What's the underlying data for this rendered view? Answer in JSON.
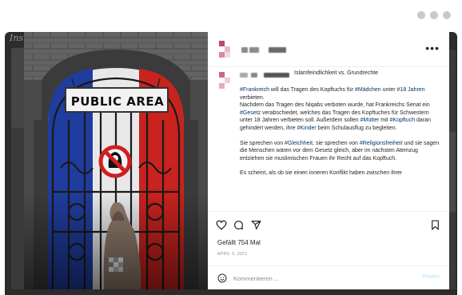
{
  "backdrop": {
    "logo_fragment": "Ins"
  },
  "photo": {
    "sign_text": "PUBLIC AREA",
    "colors": {
      "blue": "#1f3d9e",
      "white": "#e8e8ea",
      "red": "#c8231e",
      "stone": "#6b6b6b"
    }
  },
  "post": {
    "caption_title": "Islamfeindlichkeit vs. Grundrechte",
    "paragraph1": {
      "t1": "#Frankreich",
      "t2": " will das Tragen des Kopftuchs für ",
      "t3": "#Mädchen",
      "t4": " unter ",
      "t5": "#18 Jahren",
      "t6": " verbieten.",
      "t7": "Nachdem das Tragen des Niqabs verboten wurde, hat Frankreichs Senat ein ",
      "t8": "#Gesetz",
      "t9": " verabschiedet, welches das Tragen des Kopftuches für Schwestern unter 18 Jahren verbieten soll. Außerdem sollen ",
      "t10": "#Mütter",
      "t11": " mit ",
      "t12": "#Kopftuch",
      "t13": " daran gehindert werden, ihre ",
      "t14": "#Kinder",
      "t15": " beim Schulausflug zu begleiten."
    },
    "paragraph2": {
      "t1": "Sie sprechen von ",
      "t2": "#Gleichheit",
      "t3": ", sie sprechen von ",
      "t4": "#Religionsfreiheit",
      "t5": " und sie sagen die Menschen wären vor dem Gesetz gleich, aber im nächsten Atemzug entziehen sie muslimischen Frauen ihr Recht auf das Kopftuch."
    },
    "paragraph3": "Es scheint, als ob sie einen inneren Konflikt haben zwischen ihrer",
    "likes": "Gefällt 754 Mal",
    "date": "APRIL 3, 2021"
  },
  "comment": {
    "placeholder": "Kommentieren ...",
    "post_label": "Posten"
  }
}
